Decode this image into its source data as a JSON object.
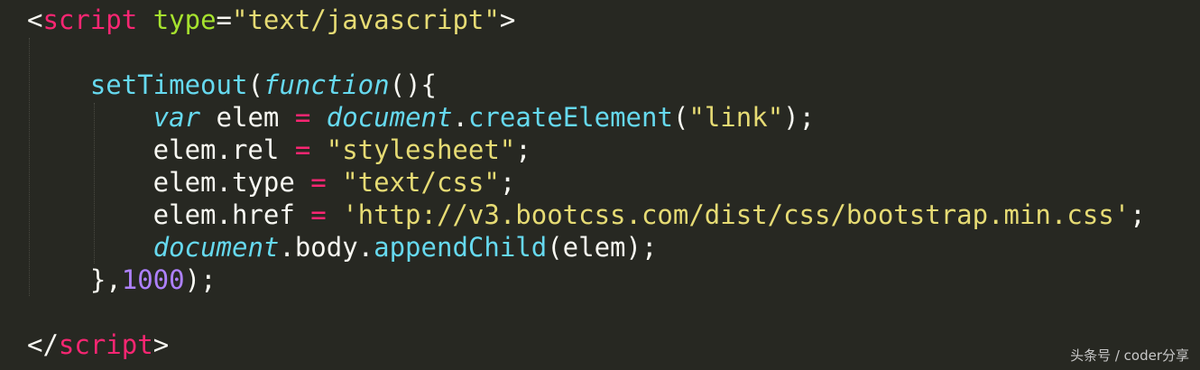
{
  "editor": {
    "background": "#272822",
    "colors": {
      "tag": "#f92672",
      "attribute": "#a6e22e",
      "string": "#e6db74",
      "function": "#66d9ef",
      "number": "#ae81ff",
      "plain": "#f8f8f2"
    },
    "lines": [
      {
        "tokens": [
          {
            "text": "<",
            "kind": "punct"
          },
          {
            "text": "script",
            "kind": "tag"
          },
          {
            "text": " ",
            "kind": "plain"
          },
          {
            "text": "type",
            "kind": "attr"
          },
          {
            "text": "=",
            "kind": "punct"
          },
          {
            "text": "\"text/javascript\"",
            "kind": "str"
          },
          {
            "text": ">",
            "kind": "punct"
          }
        ]
      },
      {
        "tokens": [
          {
            "text": "    ",
            "kind": "plain"
          },
          {
            "text": "setTimeout",
            "kind": "fn"
          },
          {
            "text": "(",
            "kind": "punct"
          },
          {
            "text": "function",
            "kind": "it"
          },
          {
            "text": "(){",
            "kind": "punct"
          }
        ]
      },
      {
        "tokens": [
          {
            "text": "        ",
            "kind": "plain"
          },
          {
            "text": "var",
            "kind": "it"
          },
          {
            "text": " elem ",
            "kind": "plain"
          },
          {
            "text": "=",
            "kind": "op"
          },
          {
            "text": " ",
            "kind": "plain"
          },
          {
            "text": "document",
            "kind": "it"
          },
          {
            "text": ".",
            "kind": "plain"
          },
          {
            "text": "createElement",
            "kind": "fn"
          },
          {
            "text": "(",
            "kind": "punct"
          },
          {
            "text": "\"link\"",
            "kind": "str"
          },
          {
            "text": ");",
            "kind": "punct"
          }
        ]
      },
      {
        "tokens": [
          {
            "text": "        elem.rel ",
            "kind": "plain"
          },
          {
            "text": "=",
            "kind": "op"
          },
          {
            "text": " ",
            "kind": "plain"
          },
          {
            "text": "\"stylesheet\"",
            "kind": "str"
          },
          {
            "text": ";",
            "kind": "punct"
          }
        ]
      },
      {
        "tokens": [
          {
            "text": "        elem.type ",
            "kind": "plain"
          },
          {
            "text": "=",
            "kind": "op"
          },
          {
            "text": " ",
            "kind": "plain"
          },
          {
            "text": "\"text/css\"",
            "kind": "str"
          },
          {
            "text": ";",
            "kind": "punct"
          }
        ]
      },
      {
        "tokens": [
          {
            "text": "        elem.href ",
            "kind": "plain"
          },
          {
            "text": "=",
            "kind": "op"
          },
          {
            "text": " ",
            "kind": "plain"
          },
          {
            "text": "'http://v3.bootcss.com/dist/css/bootstrap.min.css'",
            "kind": "str"
          },
          {
            "text": ";",
            "kind": "punct"
          }
        ]
      },
      {
        "tokens": [
          {
            "text": "        ",
            "kind": "plain"
          },
          {
            "text": "document",
            "kind": "it"
          },
          {
            "text": ".body.",
            "kind": "plain"
          },
          {
            "text": "appendChild",
            "kind": "fn"
          },
          {
            "text": "(elem);",
            "kind": "punct"
          }
        ]
      },
      {
        "tokens": [
          {
            "text": "    },",
            "kind": "punct"
          },
          {
            "text": "1000",
            "kind": "num"
          },
          {
            "text": ");",
            "kind": "punct"
          }
        ]
      },
      {
        "tokens": [
          {
            "text": "</",
            "kind": "punct"
          },
          {
            "text": "script",
            "kind": "tag"
          },
          {
            "text": ">",
            "kind": "punct"
          }
        ]
      }
    ]
  },
  "watermark": "头条号 / coder分享"
}
